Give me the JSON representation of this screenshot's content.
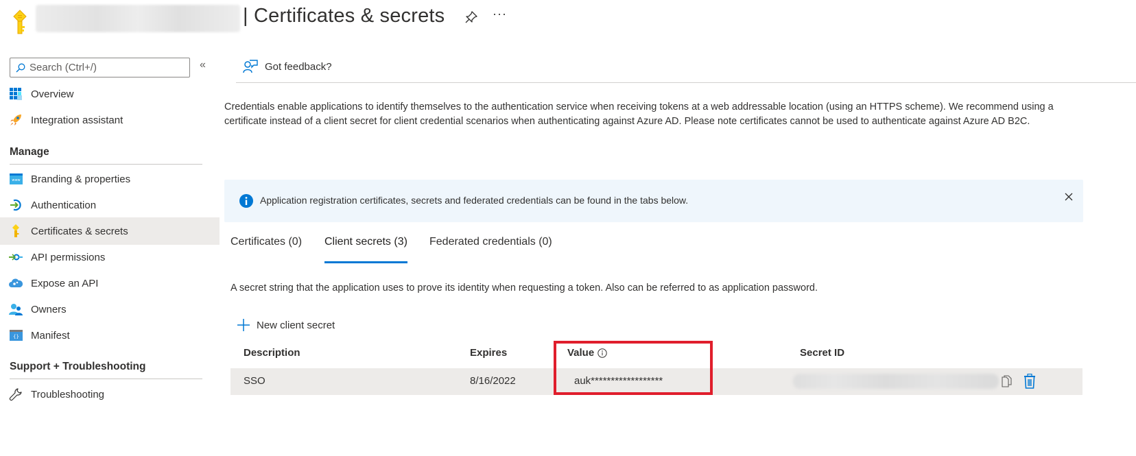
{
  "header": {
    "title": "| Certificates & secrets",
    "app_name_redacted": true,
    "pin_icon": "pin-icon",
    "more_label": "···"
  },
  "sidebar": {
    "search_placeholder": "Search (Ctrl+/)",
    "collapse_label": "«",
    "top_items": [
      {
        "label": "Overview",
        "icon": "overview-grid-icon"
      },
      {
        "label": "Integration assistant",
        "icon": "rocket-icon"
      }
    ],
    "sections": [
      {
        "title": "Manage",
        "items": [
          {
            "label": "Branding & properties",
            "icon": "www-icon"
          },
          {
            "label": "Authentication",
            "icon": "authentication-icon"
          },
          {
            "label": "Certificates & secrets",
            "icon": "key-icon",
            "active": true
          },
          {
            "label": "API permissions",
            "icon": "api-permissions-icon"
          },
          {
            "label": "Expose an API",
            "icon": "cloud-api-icon"
          },
          {
            "label": "Owners",
            "icon": "owners-icon"
          },
          {
            "label": "Manifest",
            "icon": "manifest-icon"
          }
        ]
      },
      {
        "title": "Support + Troubleshooting",
        "items": [
          {
            "label": "Troubleshooting",
            "icon": "wrench-icon"
          }
        ]
      }
    ]
  },
  "main": {
    "feedback_label": "Got feedback?",
    "description": "Credentials enable applications to identify themselves to the authentication service when receiving tokens at a web addressable location (using an HTTPS scheme). We recommend using a certificate instead of a client secret for client credential scenarios when authenticating against Azure AD. Please note certificates cannot be used to authenticate against Azure AD B2C.",
    "banner": {
      "text": "Application registration certificates, secrets and federated credentials can be found in the tabs below.",
      "close_label": "×"
    },
    "tabs": [
      {
        "label": "Certificates (0)",
        "active": false
      },
      {
        "label": "Client secrets (3)",
        "active": true
      },
      {
        "label": "Federated credentials (0)",
        "active": false
      }
    ],
    "tab_description": "A secret string that the application uses to prove its identity when requesting a token. Also can be referred to as application password.",
    "new_secret_label": "New client secret",
    "table": {
      "columns": [
        "Description",
        "Expires",
        "Value",
        "Secret ID"
      ],
      "rows": [
        {
          "description": "SSO",
          "expires": "8/16/2022",
          "value": "auk******************",
          "secret_id_redacted": true
        }
      ]
    },
    "highlight_color": "#e01e2c",
    "accent_color": "#0078d4"
  }
}
